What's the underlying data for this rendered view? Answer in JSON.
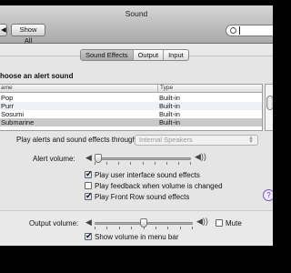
{
  "window": {
    "title": "Sound"
  },
  "toolbar": {
    "back_label": "◀",
    "show_all_label": "Show All",
    "search_value": "",
    "search_placeholder": ""
  },
  "tabs": [
    {
      "label": "Sound Effects",
      "active": true
    },
    {
      "label": "Output",
      "active": false
    },
    {
      "label": "Input",
      "active": false
    }
  ],
  "sound_effects": {
    "choose_label": "hoose an alert sound",
    "columns": {
      "name": "ame",
      "type": "Type"
    },
    "rows": [
      {
        "name": "Pop",
        "type": "Built-in",
        "selected": false
      },
      {
        "name": "Purr",
        "type": "Built-in",
        "selected": false
      },
      {
        "name": "Sosumi",
        "type": "Built-in",
        "selected": false
      },
      {
        "name": "Submarine",
        "type": "Built-in",
        "selected": true
      }
    ],
    "play_through_label": "Play alerts and sound effects through:",
    "play_through_value": "Internal Speakers",
    "alert_volume_label": "Alert volume:",
    "alert_volume_level": 0.0,
    "checkboxes": [
      {
        "label": "Play user interface sound effects",
        "checked": true
      },
      {
        "label": "Play feedback when volume is changed",
        "checked": false
      },
      {
        "label": "Play Front Row sound effects",
        "checked": true
      }
    ]
  },
  "output": {
    "volume_label": "Output volume:",
    "volume_level": 0.5,
    "mute_label": "Mute",
    "mute_checked": false,
    "show_in_menu_bar_label": "Show volume in menu bar",
    "show_in_menu_bar_checked": true
  },
  "help_label": "?"
}
